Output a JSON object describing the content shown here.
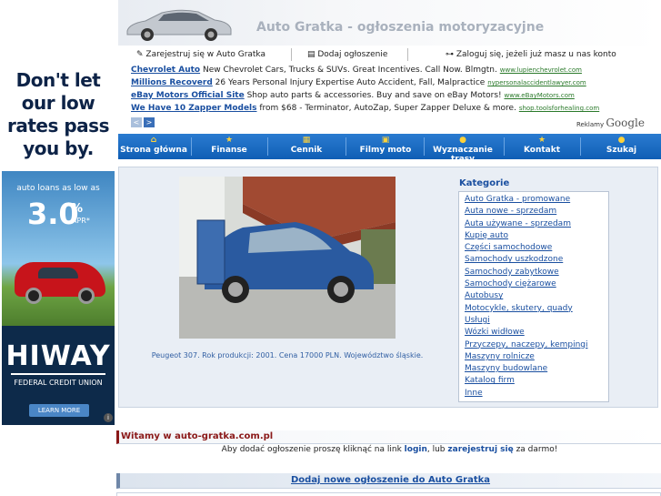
{
  "ad": {
    "headline": "Don't let our low rates pass you by.",
    "subline": "auto loans as low as",
    "rate": "3.0",
    "rate_unit": "%",
    "rate_suffix": "APR*",
    "brand": "HIWAY",
    "brand_sub": "FEDERAL CREDIT UNION",
    "cta": "LEARN MORE",
    "info": "i"
  },
  "header": {
    "title": "Auto Gratka - ogłoszenia motoryzacyjne"
  },
  "userbar": {
    "register": "Zarejestruj się w Auto Gratka",
    "add": "Dodaj ogłoszenie",
    "login": "Zaloguj się, jeżeli już masz u nas konto"
  },
  "sponsored": [
    {
      "title": "Chevrolet Auto",
      "text": "New Chevrolet Cars, Trucks & SUVs. Great Incentives. Call Now. Blmgtn.",
      "url": "www.lupienchevrolet.com"
    },
    {
      "title": "Millions Recoverd",
      "text": "26 Years Personal Injury Expertise Auto Accident, Fall, Malpractice",
      "url": "nypersonalaccidentlawyer.com"
    },
    {
      "title": "eBay Motors Official Site",
      "text": "Shop auto parts & accessories. Buy and save on eBay Motors!",
      "url": "www.eBayMotors.com"
    },
    {
      "title": "We Have 10 Zapper Models",
      "text": "from $68 - Terminator, AutoZap, Super Zapper Deluxe & more.",
      "url": "shop.toolsforhealing.com"
    }
  ],
  "ad_nav": {
    "prev": "<",
    "next": ">"
  },
  "reklamy": {
    "label": "Reklamy",
    "brand": "Google"
  },
  "nav": [
    {
      "label": "Strona główna",
      "icon": "home-icon"
    },
    {
      "label": "Finanse",
      "icon": "star-icon"
    },
    {
      "label": "Cennik",
      "icon": "price-icon"
    },
    {
      "label": "Filmy moto",
      "icon": "film-icon"
    },
    {
      "label": "Wyznaczanie trasy",
      "icon": "route-icon"
    },
    {
      "label": "Kontakt",
      "icon": "star-icon"
    },
    {
      "label": "Szukaj",
      "icon": "search-icon"
    }
  ],
  "featured": {
    "caption": "Peugeot 307. Rok produkcji: 2001. Cena 17000 PLN. Województwo śląskie."
  },
  "categories": {
    "title": "Kategorie",
    "items": [
      "Auto Gratka - promowane",
      "Auta nowe - sprzedam",
      "Auta używane - sprzedam",
      "Kupię auto",
      "Części samochodowe",
      "Samochody uszkodzone",
      "Samochody zabytkowe",
      "Samochody ciężarowe",
      "Autobusy",
      "Motocykle, skutery, quady",
      "Usługi",
      "Wózki widłowe",
      "Przyczepy, naczepy, kempingi",
      "Maszyny rolnicze",
      "Maszyny budowlane",
      "Katalog firm",
      "Inne"
    ]
  },
  "welcome": {
    "title": "Witamy w auto-gratka.com.pl",
    "text_before": "Aby dodać ogłoszenie proszę kliknąć na link",
    "login": "login",
    "text_mid": ", lub",
    "register": "zarejestruj się",
    "text_after": "za darmo!"
  },
  "addnew": {
    "label": "Dodaj nowe ogłoszenie do Auto Gratka"
  }
}
